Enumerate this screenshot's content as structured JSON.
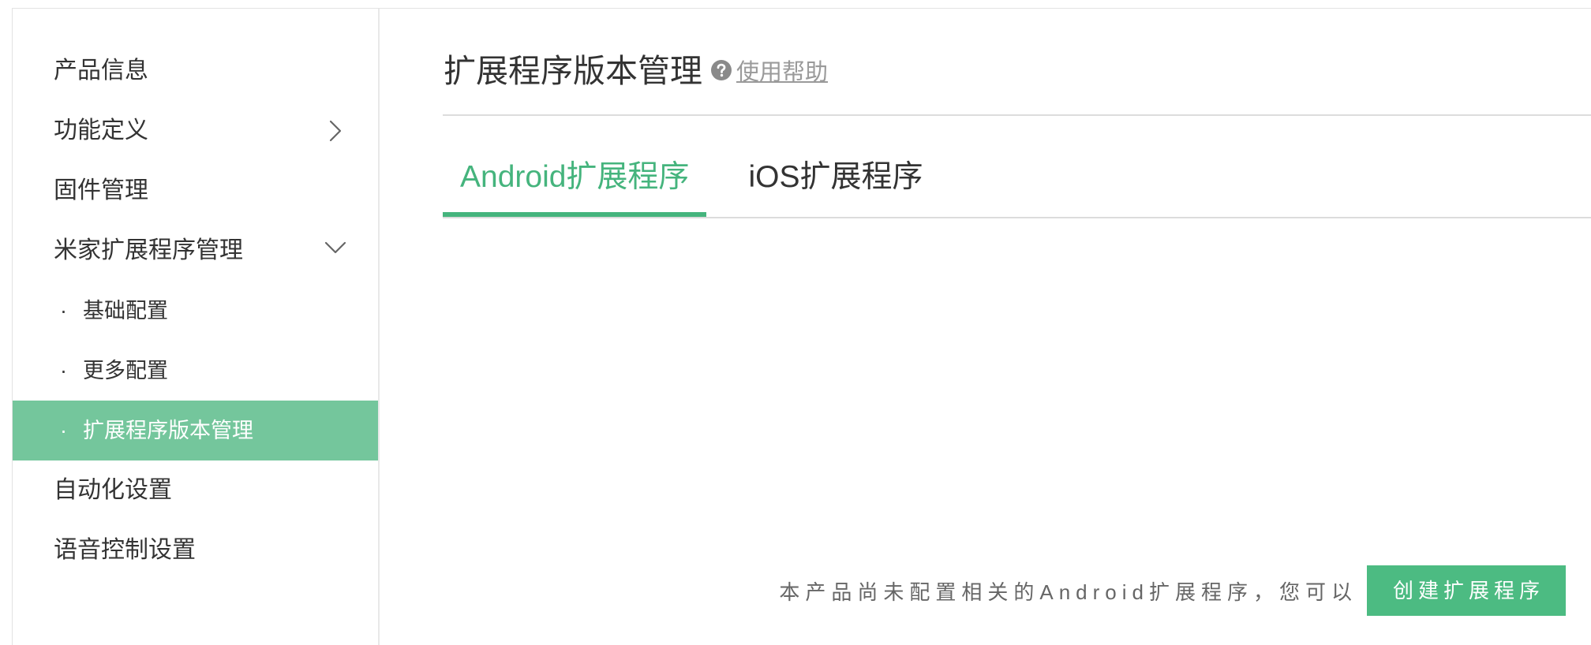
{
  "sidebar": {
    "bullet": "·",
    "items": [
      {
        "label": "产品信息"
      },
      {
        "label": "功能定义",
        "icon": "chevron-right-icon"
      },
      {
        "label": "固件管理"
      },
      {
        "label": "米家扩展程序管理",
        "icon": "chevron-down-icon",
        "expanded": true,
        "children": [
          {
            "label": "基础配置",
            "selected": false
          },
          {
            "label": "更多配置",
            "selected": false
          },
          {
            "label": "扩展程序版本管理",
            "selected": true
          }
        ]
      },
      {
        "label": "自动化设置"
      },
      {
        "label": "语音控制设置"
      }
    ]
  },
  "header": {
    "title": "扩展程序版本管理",
    "help_icon": "question-circle-icon",
    "help_link": "使用帮助"
  },
  "tabs": [
    {
      "label": "Android扩展程序",
      "active": true
    },
    {
      "label": "iOS扩展程序",
      "active": false
    }
  ],
  "empty_state": {
    "message": "本产品尚未配置相关的Android扩展程序，您可以",
    "create_button": "创建扩展程序"
  },
  "colors": {
    "accent": "#45b47d",
    "sidebar_selected_bg": "#74c69c",
    "button_bg": "#4cbb82",
    "text": "#333333",
    "muted_text": "#666666",
    "border": "#e3e3e3"
  }
}
